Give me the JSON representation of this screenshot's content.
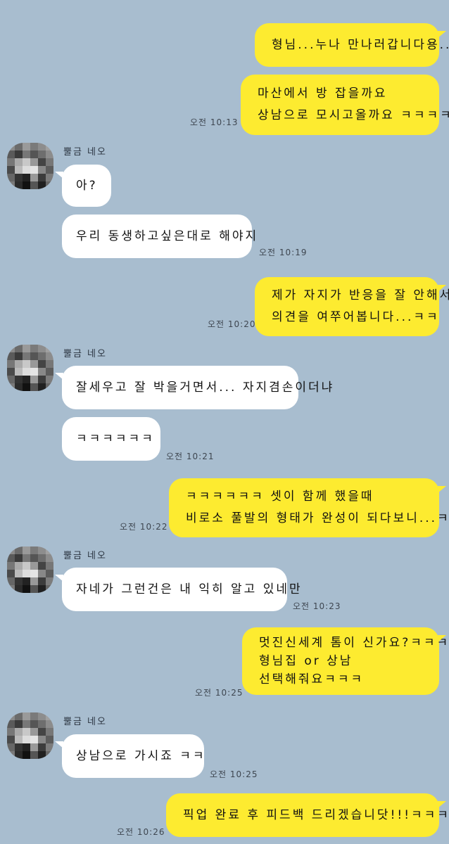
{
  "messages": [
    {
      "from": "me",
      "lines": [
        "형님...누나 만나러갑니다용.."
      ]
    },
    {
      "from": "me",
      "lines": [
        "마산에서 방 잡을까요",
        "상남으로 모시고올까요 ㅋㅋㅋㅋ"
      ],
      "time": "오전 10:13"
    },
    {
      "from": "them",
      "sender": "뿔금 네오",
      "lines": [
        "아?"
      ]
    },
    {
      "from": "them",
      "lines": [
        "우리 동생하고싶은대로 해야지"
      ],
      "time": "오전 10:19"
    },
    {
      "from": "me",
      "lines": [
        "제가 자지가 반응을 잘 안해서",
        "의견을 여쭈어봅니다...ㅋㅋ"
      ],
      "time": "오전 10:20"
    },
    {
      "from": "them",
      "sender": "뿔금 네오",
      "lines": [
        "잘세우고 잘 박을거면서... 자지겸손이더냐"
      ]
    },
    {
      "from": "them",
      "lines": [
        "ㅋㅋㅋㅋㅋㅋ"
      ],
      "time": "오전 10:21"
    },
    {
      "from": "me",
      "lines": [
        "ㅋㅋㅋㅋㅋㅋ 셋이 함께 했을때",
        "비로소 풀발의 형태가 완성이 되다보니...ㅋㅋ"
      ],
      "time": "오전 10:22"
    },
    {
      "from": "them",
      "sender": "뿔금 네오",
      "lines": [
        "자네가 그런건은 내 익히 알고 있네만"
      ],
      "time": "오전 10:23"
    },
    {
      "from": "me",
      "lines": [
        "멋진신세계 톰이 신가요?ㅋㅋㅋ",
        "형님집 or 상남",
        "선택해줘요ㅋㅋㅋ"
      ],
      "time": "오전 10:25"
    },
    {
      "from": "them",
      "sender": "뿔금 네오",
      "lines": [
        "상남으로 가시죠 ㅋㅋ"
      ],
      "time": "오전 10:25"
    },
    {
      "from": "me",
      "lines": [
        "픽업 완료 후 피드백 드리겠습니닷!!!ㅋㅋㅋㅋ"
      ],
      "time": "오전 10:26"
    }
  ]
}
